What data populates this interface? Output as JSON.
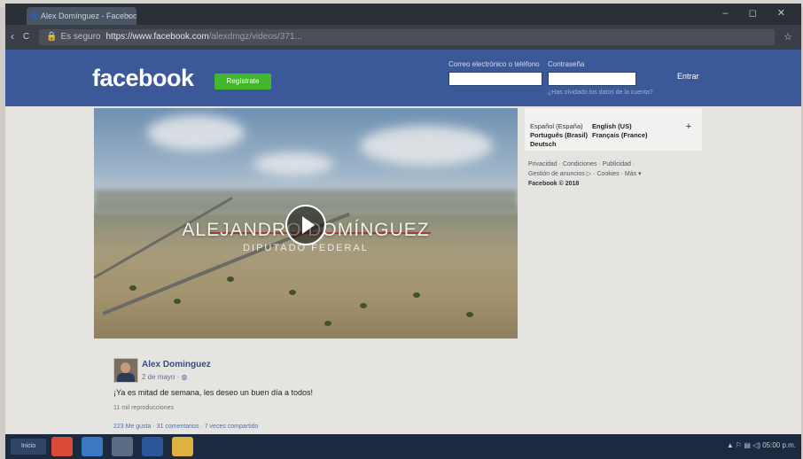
{
  "browser": {
    "tab_title": "Alex Domínguez - Facebook",
    "tab_close": "×",
    "window_controls": "– ◻ ✕",
    "back_glyph": "‹",
    "reload_glyph": "C",
    "secure_label": "Es seguro",
    "url_host": "https://www.facebook.com",
    "url_path": "/alexdmgz/videos/371...",
    "bookmark_glyph": "☆"
  },
  "header": {
    "logo": "facebook",
    "signup_button": "Regístrate",
    "email_label": "Correo electrónico o teléfono",
    "password_label": "Contraseña",
    "email_value": "",
    "password_value": "",
    "forgot_link": "¿Has olvidado los datos de la cuenta?",
    "login_button": "Entrar"
  },
  "video": {
    "overlay_name": "ALEJANDRO DOMÍNGUEZ",
    "overlay_role": "DIPUTADO FEDERAL"
  },
  "post": {
    "author": "Alex Dominguez",
    "date": "2 de mayo · ◍",
    "text": "¡Ya es mitad de semana, les deseo un buen día a todos!",
    "views": "11 mil reproducciones",
    "stats": "223 Me gusta · 31 comentarios · 7 veces compartido"
  },
  "languages": {
    "items": [
      "Español (España)",
      "English (US)",
      "Português (Brasil)",
      "Français (France)",
      "Deutsch"
    ],
    "more": "+"
  },
  "footer": {
    "line1": "Privacidad · Condiciones · Publicidad ·",
    "line2": "Gestión de anuncios ▷ · Cookies · Más ▾",
    "copyright": "Facebook © 2018"
  },
  "taskbar": {
    "start": "Inicio",
    "tray": "▲ ⚐ ▤ ◁) 05:00 p.m."
  },
  "colors": {
    "fb_blue": "#3b5998",
    "signup_green": "#42b72a",
    "taskbar": "#1c2a3f"
  }
}
